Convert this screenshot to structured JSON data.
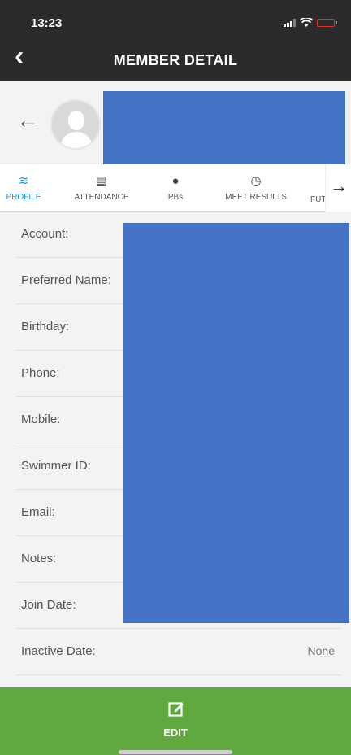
{
  "status_bar": {
    "time": "13:23"
  },
  "nav": {
    "back_icon": "chevron-left-icon",
    "title": "MEMBER DETAIL"
  },
  "header": {
    "back_icon": "arrow-left-icon",
    "avatar_icon": "user-placeholder-icon"
  },
  "tabs": [
    {
      "label": "PROFILE",
      "icon": "swimmer-icon",
      "active": true
    },
    {
      "label": "ATTENDANCE",
      "icon": "clipboard-icon",
      "active": false
    },
    {
      "label": "PBs",
      "icon": "medal-icon",
      "active": false
    },
    {
      "label": "MEET RESULTS",
      "icon": "stopwatch-icon",
      "active": false
    },
    {
      "label": "FUT",
      "icon": "",
      "active": false
    }
  ],
  "tab_more_icon": "arrow-right-icon",
  "fields": [
    {
      "label": "Account:",
      "value": ""
    },
    {
      "label": "Preferred Name:",
      "value": ""
    },
    {
      "label": "Birthday:",
      "value": ""
    },
    {
      "label": "Phone:",
      "value": ""
    },
    {
      "label": "Mobile:",
      "value": ""
    },
    {
      "label": "Swimmer ID:",
      "value": ""
    },
    {
      "label": "Email:",
      "value": ""
    },
    {
      "label": "Notes:",
      "value": ""
    },
    {
      "label": "Join Date:",
      "value": ""
    },
    {
      "label": "Inactive Date:",
      "value": "None"
    }
  ],
  "bottom": {
    "edit_label": "EDIT",
    "edit_icon": "edit-icon"
  },
  "colors": {
    "nav_bg": "#2b2b2b",
    "accent": "#1a8fd8",
    "edit_bg": "#5fa93e",
    "redaction": "#4472c4"
  }
}
